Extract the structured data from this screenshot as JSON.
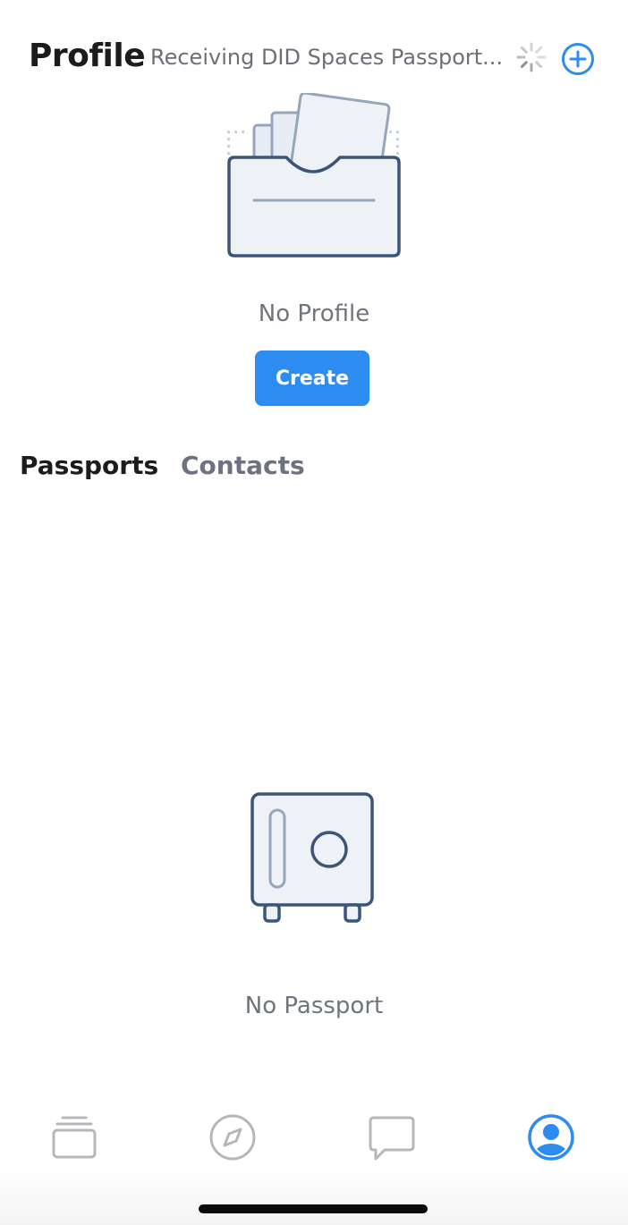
{
  "header": {
    "title": "Profile",
    "status": "Receiving DID Spaces Passport...",
    "add_icon": "plus-circle-icon",
    "spinner_icon": "loading-spinner-icon"
  },
  "profile": {
    "empty_text": "No Profile",
    "create_label": "Create",
    "illustration_icon": "empty-inbox-illustration"
  },
  "tabs": [
    {
      "label": "Passports",
      "active": true
    },
    {
      "label": "Contacts",
      "active": false
    }
  ],
  "passports": {
    "empty_text": "No Passport",
    "illustration_icon": "safe-illustration"
  },
  "bottom_nav": [
    {
      "icon": "cards-stack-icon",
      "active": false
    },
    {
      "icon": "compass-icon",
      "active": false
    },
    {
      "icon": "chat-bubble-icon",
      "active": false
    },
    {
      "icon": "user-profile-icon",
      "active": true
    }
  ],
  "colors": {
    "accent": "#2d8cf0",
    "title": "#1c1c1e",
    "muted": "#6c7280",
    "illustration_stroke": "#3b5578",
    "illustration_fill": "#eef2f6",
    "nav_inactive": "#b5b7bb"
  }
}
